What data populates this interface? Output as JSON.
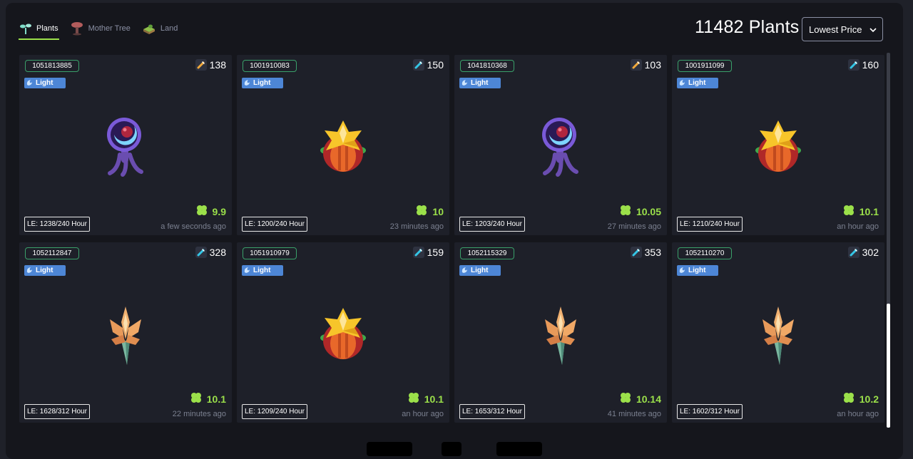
{
  "tabs": [
    {
      "label": "Plants",
      "icon": "plant-sprout-icon",
      "active": true
    },
    {
      "label": "Mother Tree",
      "icon": "mother-tree-icon",
      "active": false
    },
    {
      "label": "Land",
      "icon": "land-tile-icon",
      "active": false
    }
  ],
  "header": {
    "count_text": "11482 Plants",
    "sort": {
      "selected": "Lowest Price",
      "options": [
        "Lowest Price"
      ]
    }
  },
  "colors": {
    "accent_green": "#9be04a",
    "light_blue": "#4d86d6",
    "tool_orange": "#f0a83a",
    "tool_cyan": "#34c6e6",
    "badge_border": "#3aa06a"
  },
  "cards": [
    {
      "id": "1051813885",
      "type": "Light",
      "tool_color": "orange",
      "tool_value": "138",
      "plant": "moon-orb",
      "price": "9.9",
      "le": "LE: 1238/240 Hour",
      "time": "a few seconds ago"
    },
    {
      "id": "1001910083",
      "type": "Light",
      "tool_color": "cyan",
      "tool_value": "150",
      "plant": "pumpkin-flower",
      "price": "10",
      "le": "LE: 1200/240 Hour",
      "time": "23 minutes ago"
    },
    {
      "id": "1041810368",
      "type": "Light",
      "tool_color": "orange",
      "tool_value": "103",
      "plant": "moon-orb",
      "price": "10.05",
      "le": "LE: 1203/240 Hour",
      "time": "27 minutes ago"
    },
    {
      "id": "1001911099",
      "type": "Light",
      "tool_color": "cyan",
      "tool_value": "160",
      "plant": "pumpkin-flower",
      "price": "10.1",
      "le": "LE: 1210/240 Hour",
      "time": "an hour ago"
    },
    {
      "id": "1052112847",
      "type": "Light",
      "tool_color": "cyan",
      "tool_value": "328",
      "plant": "crystal-lily",
      "price": "10.1",
      "le": "LE: 1628/312 Hour",
      "time": "22 minutes ago"
    },
    {
      "id": "1051910979",
      "type": "Light",
      "tool_color": "cyan",
      "tool_value": "159",
      "plant": "pumpkin-flower",
      "price": "10.1",
      "le": "LE: 1209/240 Hour",
      "time": "an hour ago"
    },
    {
      "id": "1052115329",
      "type": "Light",
      "tool_color": "cyan",
      "tool_value": "353",
      "plant": "crystal-lily",
      "price": "10.14",
      "le": "LE: 1653/312 Hour",
      "time": "41 minutes ago"
    },
    {
      "id": "1052110270",
      "type": "Light",
      "tool_color": "cyan",
      "tool_value": "302",
      "plant": "crystal-lily",
      "price": "10.2",
      "le": "LE: 1602/312 Hour",
      "time": "an hour ago"
    }
  ]
}
